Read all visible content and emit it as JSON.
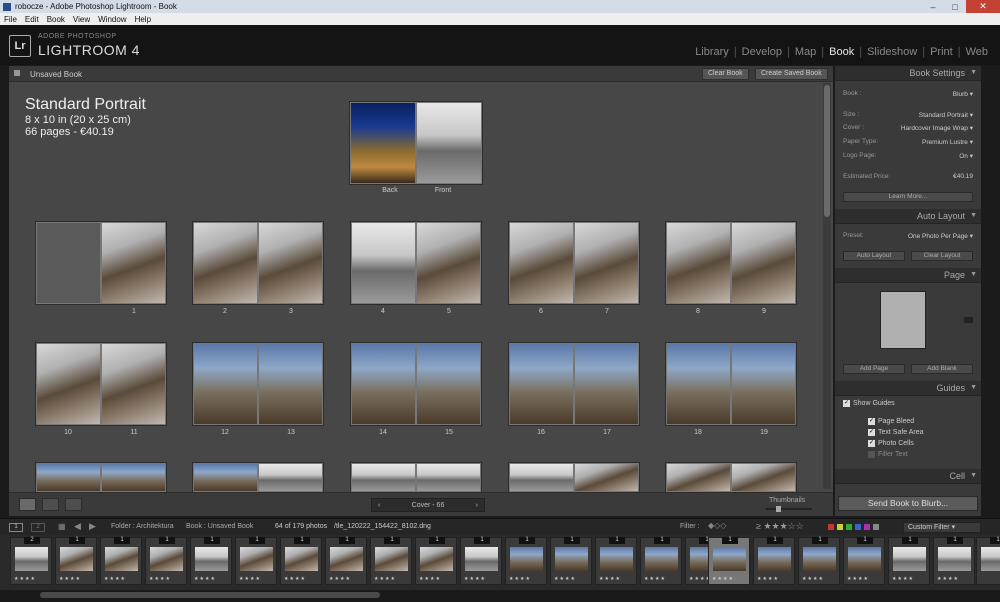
{
  "window": {
    "title": "robocze - Adobe Photoshop Lightroom - Book"
  },
  "menu": [
    "File",
    "Edit",
    "Book",
    "View",
    "Window",
    "Help"
  ],
  "brand": {
    "sub": "ADOBE PHOTOSHOP",
    "name": "LIGHTROOM 4",
    "logo": "Lr"
  },
  "modules": {
    "items": [
      "Library",
      "Develop",
      "Map",
      "Book",
      "Slideshow",
      "Print",
      "Web"
    ],
    "active": "Book"
  },
  "book_panel": {
    "title": "Unsaved Book",
    "clear_btn": "Clear Book",
    "create_btn": "Create Saved Book",
    "heading": "Standard Portrait",
    "size_line": "8 x 10 in (20 x 25 cm)",
    "pages_line": "66 pages - €40.19",
    "cover_labels": {
      "back": "Back",
      "front": "Front"
    },
    "spreads": [
      {
        "left": "",
        "right": "1"
      },
      {
        "left": "2",
        "right": "3"
      },
      {
        "left": "4",
        "right": "5"
      },
      {
        "left": "6",
        "right": "7"
      },
      {
        "left": "8",
        "right": "9"
      },
      {
        "left": "10",
        "right": "11"
      },
      {
        "left": "12",
        "right": "13"
      },
      {
        "left": "14",
        "right": "15"
      },
      {
        "left": "16",
        "right": "17"
      },
      {
        "left": "18",
        "right": "19"
      }
    ]
  },
  "bottom_toolbar": {
    "pager_label": "Cover - 66",
    "thumbnails_label": "Thumbnails"
  },
  "right_panel": {
    "book_settings": {
      "title": "Book Settings",
      "rows": [
        {
          "k": "Book :",
          "v": "Blurb ▾"
        },
        {
          "k": "Size :",
          "v": "Standard Portrait ▾"
        },
        {
          "k": "Cover :",
          "v": "Hardcover Image Wrap ▾"
        },
        {
          "k": "Paper Type:",
          "v": "Premium Lustre ▾"
        },
        {
          "k": "Logo Page:",
          "v": "On ▾"
        },
        {
          "k": "Estimated Price:",
          "v": "€40.19"
        }
      ],
      "learn_more": "Learn More..."
    },
    "auto_layout": {
      "title": "Auto Layout",
      "preset_label": "Preset:",
      "preset_value": "One Photo Per Page ▾",
      "auto_btn": "Auto Layout",
      "clear_btn": "Clear Layout"
    },
    "page": {
      "title": "Page",
      "add_page": "Add Page",
      "add_blank": "Add Blank"
    },
    "guides": {
      "title": "Guides",
      "show_guides": "Show Guides",
      "items": [
        "Page Bleed",
        "Text Safe Area",
        "Photo Cells",
        "Filler Text"
      ],
      "checked": [
        true,
        true,
        true,
        false
      ]
    },
    "cell": {
      "title": "Cell"
    },
    "send_btn": "Send Book to Blurb..."
  },
  "filmbar": {
    "folder": "Folder : Architektura",
    "collection": "Book : Unsaved Book",
    "count": "64 of 179 photos",
    "filename": "/tle_120222_154422_8102.dng",
    "filter_label": "Filter :",
    "custom_filter": "Custom Filter"
  },
  "filmstrip": {
    "badges": [
      "2",
      "1",
      "1",
      "1",
      "1",
      "1",
      "1",
      "1",
      "1",
      "1",
      "1",
      "1",
      "1",
      "1",
      "1",
      "1",
      "1",
      "1",
      "1",
      "1",
      "1",
      "1",
      "1"
    ],
    "stars": "★★★★"
  }
}
